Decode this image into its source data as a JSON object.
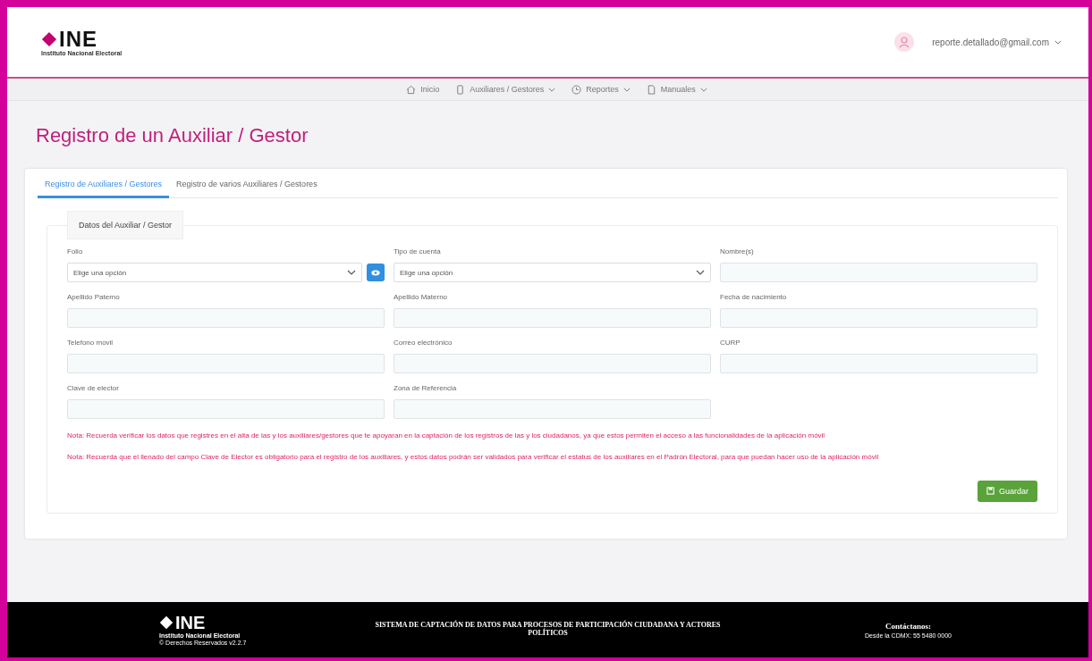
{
  "header": {
    "logo_text": "INE",
    "logo_subtitle": "Instituto Nacional Electoral",
    "user_email": "reporte.detallado@gmail.com"
  },
  "nav": [
    {
      "label": "Inicio",
      "dropdown": false
    },
    {
      "label": "Auxiliares / Gestores",
      "dropdown": true
    },
    {
      "label": "Reportes",
      "dropdown": true
    },
    {
      "label": "Manuales",
      "dropdown": true
    }
  ],
  "page_title": "Registro de un Auxiliar / Gestor",
  "tabs": [
    {
      "label": "Registro de Auxiliares / Gestores",
      "selected": true
    },
    {
      "label": "Registro de varios Auxiliares / Gestores",
      "selected": false
    }
  ],
  "section_title": "Datos del Auxiliar / Gestor",
  "fields": [
    {
      "label": "Folio",
      "kind": "select",
      "placeholder": "Elige una opción",
      "action_button": true
    },
    {
      "label": "Tipo de cuenta",
      "kind": "select",
      "placeholder": "Elige una opción",
      "action_button": false
    },
    {
      "label": "Nombre(s)",
      "kind": "text"
    },
    {
      "label": "Apellido Paterno",
      "kind": "text"
    },
    {
      "label": "Apellido Materno",
      "kind": "text"
    },
    {
      "label": "Fecha de nacimiento",
      "kind": "text"
    },
    {
      "label": "Telefono movil",
      "kind": "text"
    },
    {
      "label": "Correo electrónico",
      "kind": "text"
    },
    {
      "label": "CURP",
      "kind": "text"
    },
    {
      "label": "Clave de elector",
      "kind": "text"
    },
    {
      "label": "Zona de Referencia",
      "kind": "text"
    }
  ],
  "notes": [
    "Nota: Recuerda verificar los datos que registres en el alta de las y los auxiliares/gestores que te apoyaran en la captación de los registros de las y los ciudadanos, ya que estos permiten el acceso a las funcionalidades de la aplicación móvil",
    "Nota: Recuerda que el llenado del campo Clave de Elector es obligatorio para el registro de los auxiliares, y estos datos podrán ser validados para verificar el estatus de los auxiliares en el Padrón Electoral, para que puedan hacer uso de la aplicación móvil"
  ],
  "save_button": "Guardar",
  "footer": {
    "logo_text": "INE",
    "logo_subtitle": "Instituto Nacional Electoral",
    "copyright": "© Derechos Reservados v2.2.7",
    "system_title": "SISTEMA DE CAPTACIÓN DE DATOS PARA PROCESOS DE PARTICIPACIÓN CIUDADANA Y ACTORES POLÍTICOS",
    "contact_title": "Contáctanos:",
    "contact_phone": "Desde la CDMX: 55 5480 0000"
  }
}
